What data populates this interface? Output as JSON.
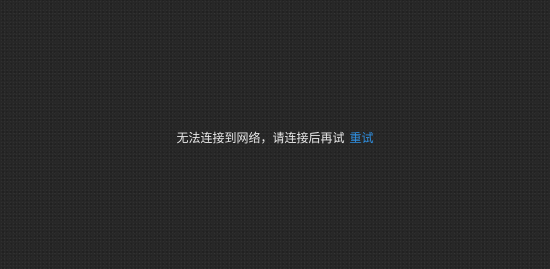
{
  "error": {
    "message": "无法连接到网络，请连接后再试",
    "retry_label": "重试"
  },
  "colors": {
    "background": "#272727",
    "text": "#e6e6e6",
    "link": "#2f8fe0"
  }
}
